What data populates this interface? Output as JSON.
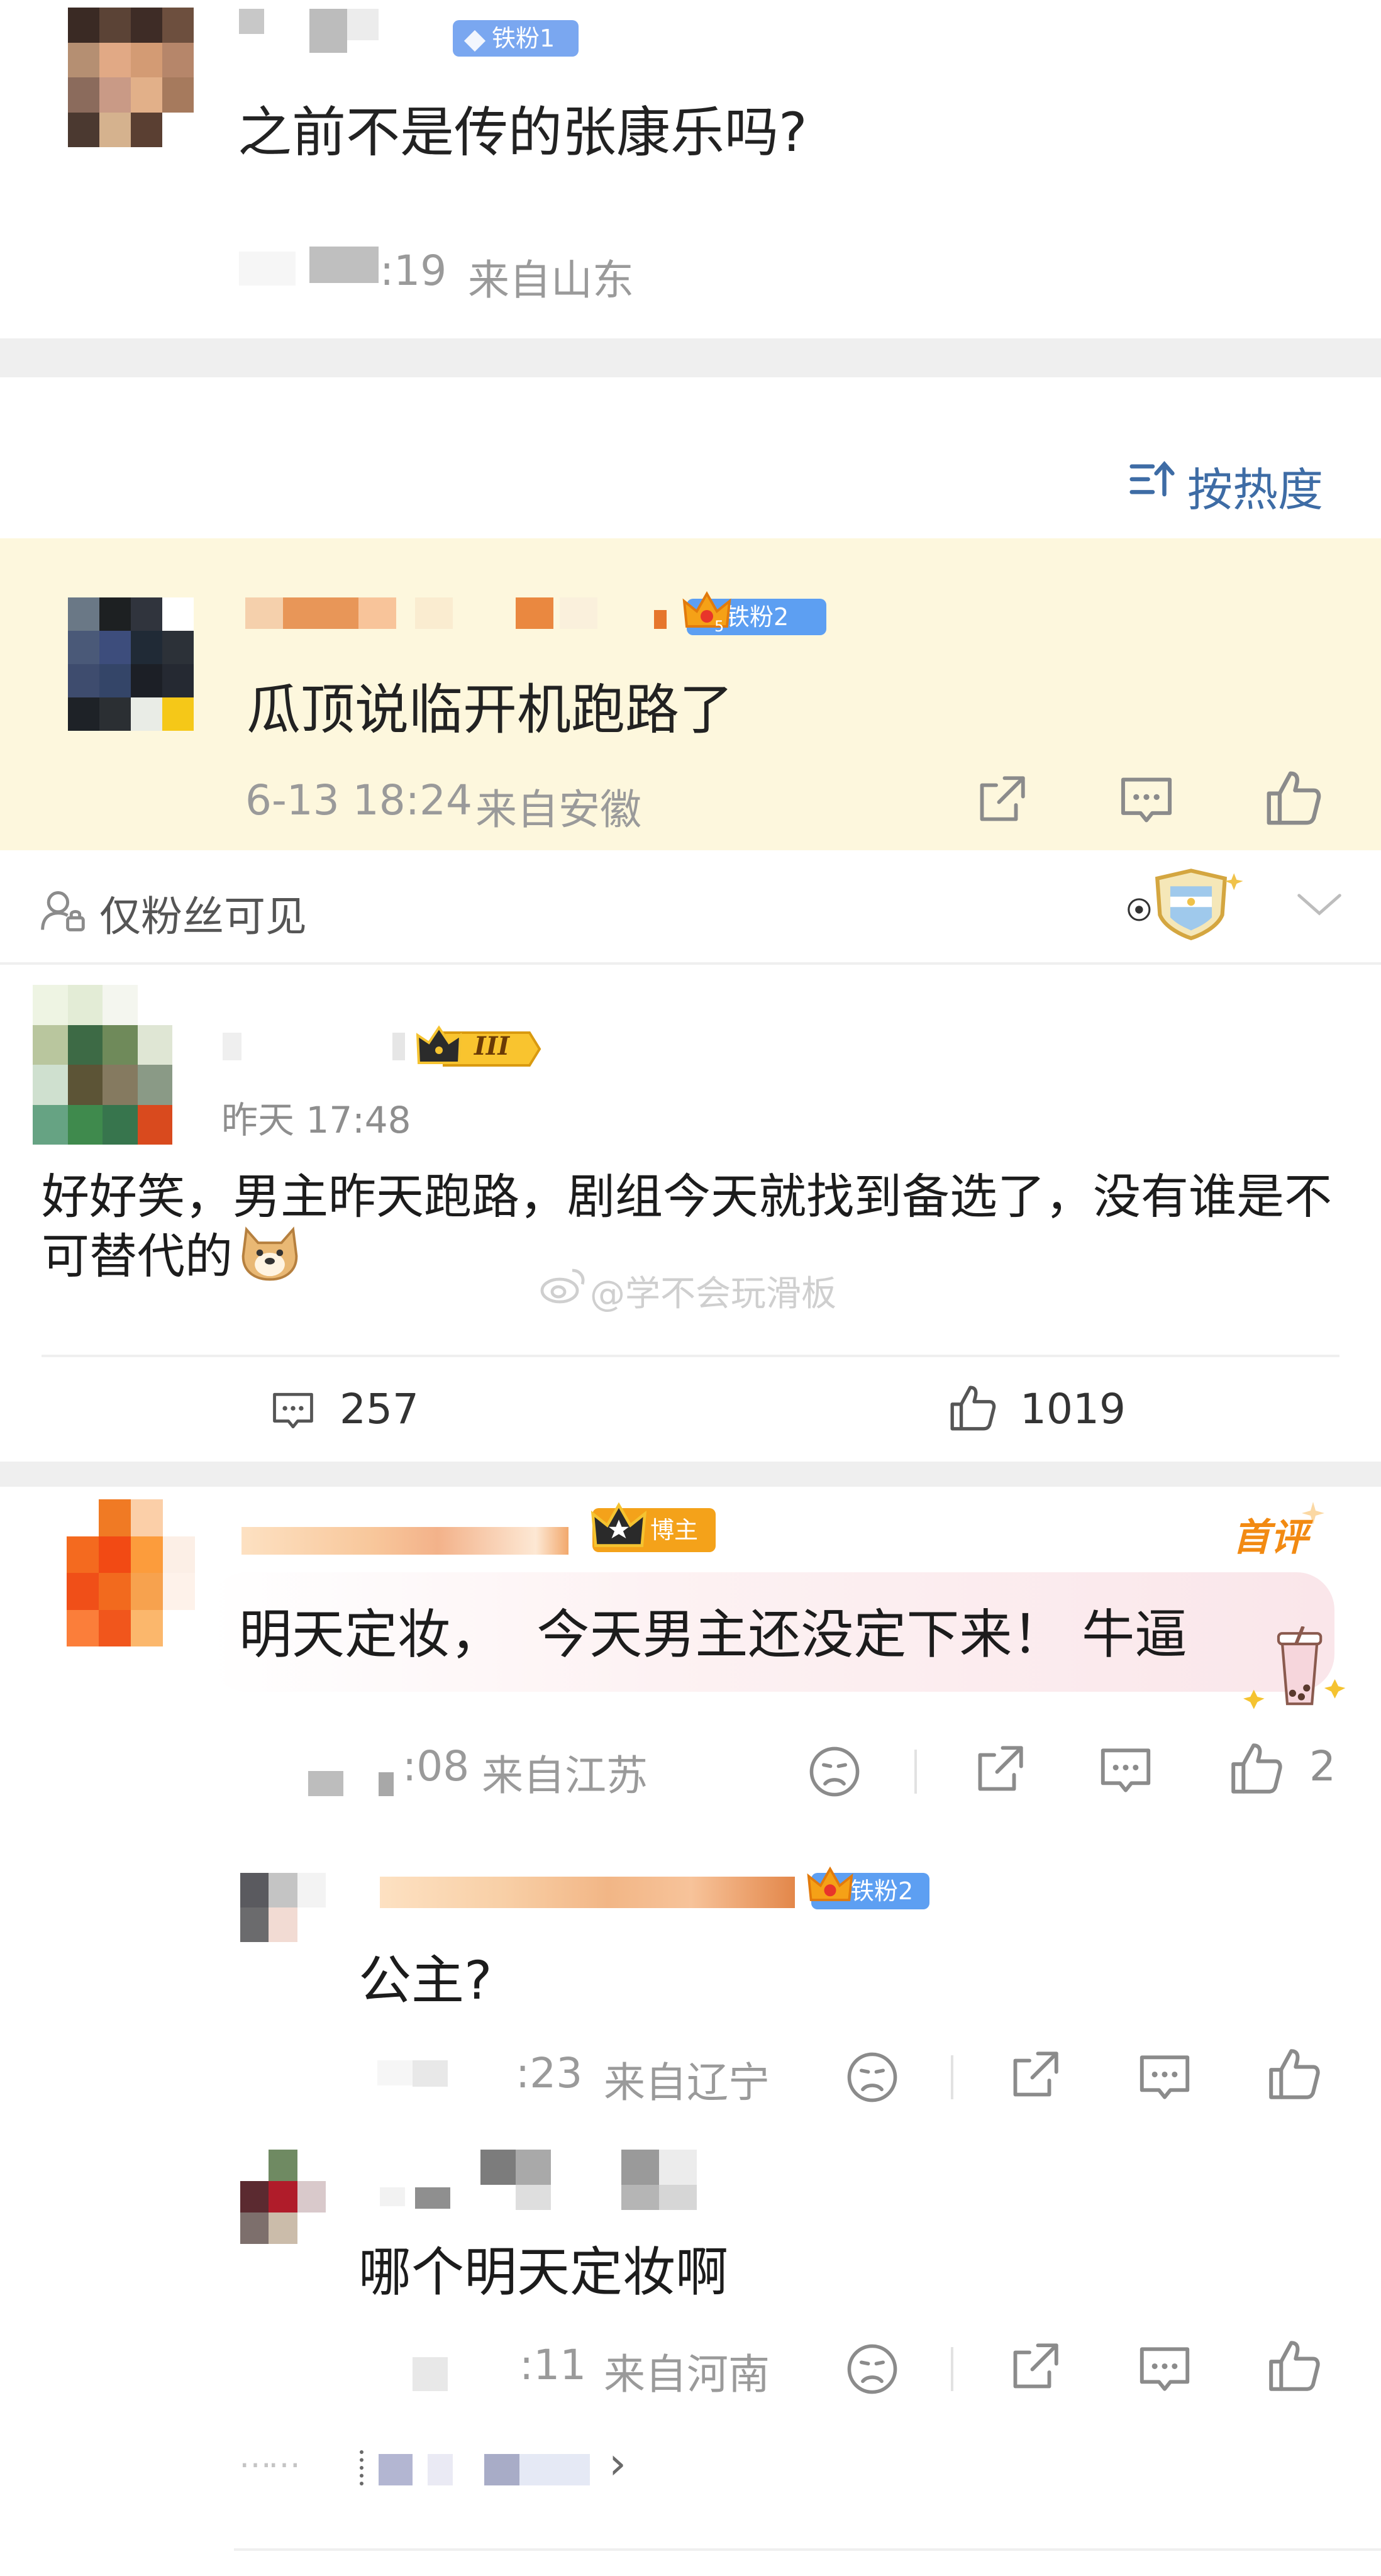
{
  "comment1": {
    "badge": "铁粉1",
    "text": "之前不是传的张康乐吗?",
    "time": ":19",
    "location": "来自山东"
  },
  "sort": {
    "label": "按热度"
  },
  "comment2": {
    "badge": "铁粉2",
    "badge_level": "5",
    "text": "瓜顶说临开机跑路了",
    "time": "6-13 18:24",
    "location": "来自安徽"
  },
  "fans_only": {
    "label": "仅粉丝可见"
  },
  "post": {
    "badge": "III",
    "time": "昨天 17:48",
    "text": "好好笑，男主昨天跑路，剧组今天就找到备选了，没有谁是不可替代的",
    "watermark": "@学不会玩滑板",
    "comments_count": "257",
    "likes_count": "1019"
  },
  "comment3": {
    "first_label": "首评",
    "badge": "博主",
    "text": "明天定妆，  今天男主还没定下来！ 牛逼",
    "time": ":08",
    "location": "来自江苏",
    "likes": "2"
  },
  "reply1": {
    "badge": "铁粉2",
    "text": "公主?",
    "time": ":23",
    "location": "来自辽宁"
  },
  "reply2": {
    "text": "哪个明天定妆啊",
    "time": ":11",
    "location": "来自河南"
  },
  "more": {
    "dots": "……",
    "arrow": "›"
  },
  "colors": {
    "highlight_bg": "#fdf7dd",
    "meta_gray": "#9a9a9a",
    "blue_link": "#3e6ca5",
    "gold": "#f0a21c",
    "first_orange": "#f28a12"
  }
}
